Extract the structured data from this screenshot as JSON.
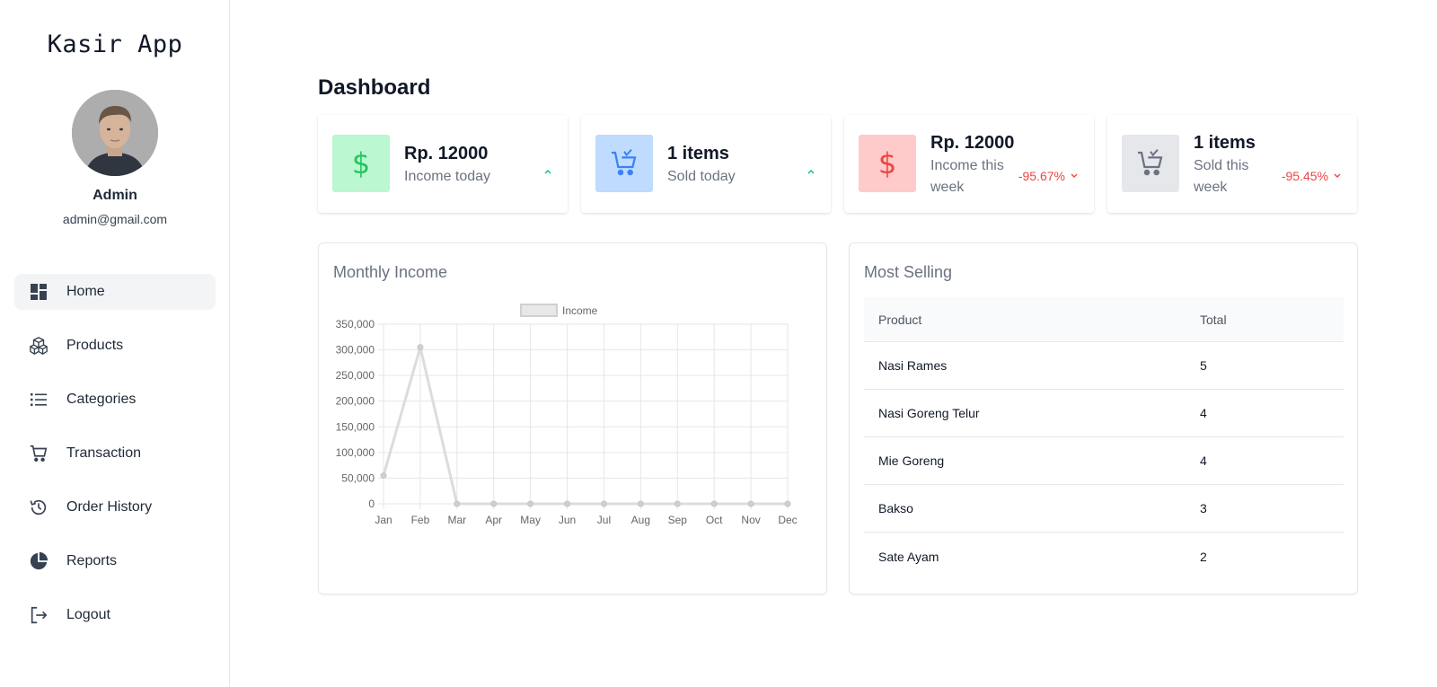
{
  "sidebar": {
    "logo": "Kasir App",
    "user": {
      "name": "Admin",
      "email": "admin@gmail.com"
    },
    "items": [
      {
        "label": "Home",
        "icon": "dashboard-icon",
        "active": true
      },
      {
        "label": "Products",
        "icon": "cubes-icon"
      },
      {
        "label": "Categories",
        "icon": "list-icon"
      },
      {
        "label": "Transaction",
        "icon": "cart-icon"
      },
      {
        "label": "Order History",
        "icon": "history-icon"
      },
      {
        "label": "Reports",
        "icon": "pie-chart-icon"
      },
      {
        "label": "Logout",
        "icon": "logout-icon"
      }
    ]
  },
  "main": {
    "title": "Dashboard",
    "stats": [
      {
        "value": "Rp. 12000",
        "label": "Income today",
        "trend": "",
        "trend_dir": "up",
        "icon": "dollar-icon",
        "icon_bg": "#bbf7d0",
        "icon_color": "#22c55e"
      },
      {
        "value": "1 items",
        "label": "Sold today",
        "trend": "",
        "trend_dir": "up",
        "icon": "cart-icon",
        "icon_bg": "#bfdbfe",
        "icon_color": "#3b82f6"
      },
      {
        "value": "Rp. 12000",
        "label": "Income this week",
        "trend": "-95.67%",
        "trend_dir": "down",
        "icon": "dollar-icon",
        "icon_bg": "#fecaca",
        "icon_color": "#ef4444"
      },
      {
        "value": "1 items",
        "label": "Sold this week",
        "trend": "-95.45%",
        "trend_dir": "down",
        "icon": "cart-icon",
        "icon_bg": "#e5e7eb",
        "icon_color": "#6b7280"
      }
    ],
    "monthly_income": {
      "title": "Monthly Income"
    },
    "most_selling": {
      "title": "Most Selling",
      "columns": [
        "Product",
        "Total"
      ],
      "rows": [
        {
          "product": "Nasi Rames",
          "total": "5"
        },
        {
          "product": "Nasi Goreng Telur",
          "total": "4"
        },
        {
          "product": "Mie Goreng",
          "total": "4"
        },
        {
          "product": "Bakso",
          "total": "3"
        },
        {
          "product": "Sate Ayam",
          "total": "2"
        }
      ]
    }
  },
  "colors": {
    "accent_green": "#10b981",
    "accent_red": "#ef4444",
    "chart_line": "#d9d9d9"
  },
  "chart_data": {
    "type": "line",
    "title": "",
    "xlabel": "",
    "ylabel": "",
    "x": [
      "Jan",
      "Feb",
      "Mar",
      "Apr",
      "May",
      "Jun",
      "Jul",
      "Aug",
      "Sep",
      "Oct",
      "Nov",
      "Dec"
    ],
    "series": [
      {
        "name": "Income",
        "values": [
          55000,
          305000,
          0,
          0,
          0,
          0,
          0,
          0,
          0,
          0,
          0,
          0
        ]
      }
    ],
    "y_ticks": [
      "0",
      "50,000",
      "100,000",
      "150,000",
      "200,000",
      "250,000",
      "300,000",
      "350,000"
    ],
    "ylim": [
      0,
      350000
    ],
    "grid": true,
    "legend": "top-center"
  }
}
